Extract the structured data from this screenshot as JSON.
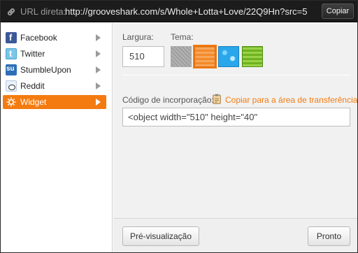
{
  "url_bar": {
    "label": "URL direta:",
    "url": "http://grooveshark.com/s/Whole+Lotta+Love/22Q9Hn?src=5",
    "copy_label": "Copiar"
  },
  "sidebar": {
    "items": [
      {
        "label": "Facebook",
        "icon": "facebook-icon"
      },
      {
        "label": "Twitter",
        "icon": "twitter-icon"
      },
      {
        "label": "StumbleUpon",
        "icon": "stumbleupon-icon"
      },
      {
        "label": "Reddit",
        "icon": "reddit-icon"
      },
      {
        "label": "Widget",
        "icon": "gear-icon",
        "active": true
      }
    ]
  },
  "widget": {
    "width_label": "Largura:",
    "width_value": "510",
    "theme_label": "Tema:",
    "themes": [
      "gray",
      "orange",
      "blue",
      "green"
    ],
    "selected_theme": "orange",
    "embed_label": "Código de incorporação:",
    "copy_clipboard_label": "Copiar para a área de transferência",
    "embed_code": "<object width=\"510\" height=\"40\""
  },
  "footer": {
    "preview_label": "Pré-visualização",
    "done_label": "Pronto"
  },
  "colors": {
    "accent": "#f47b10",
    "url_bar_bg": "#1c1c1c"
  }
}
